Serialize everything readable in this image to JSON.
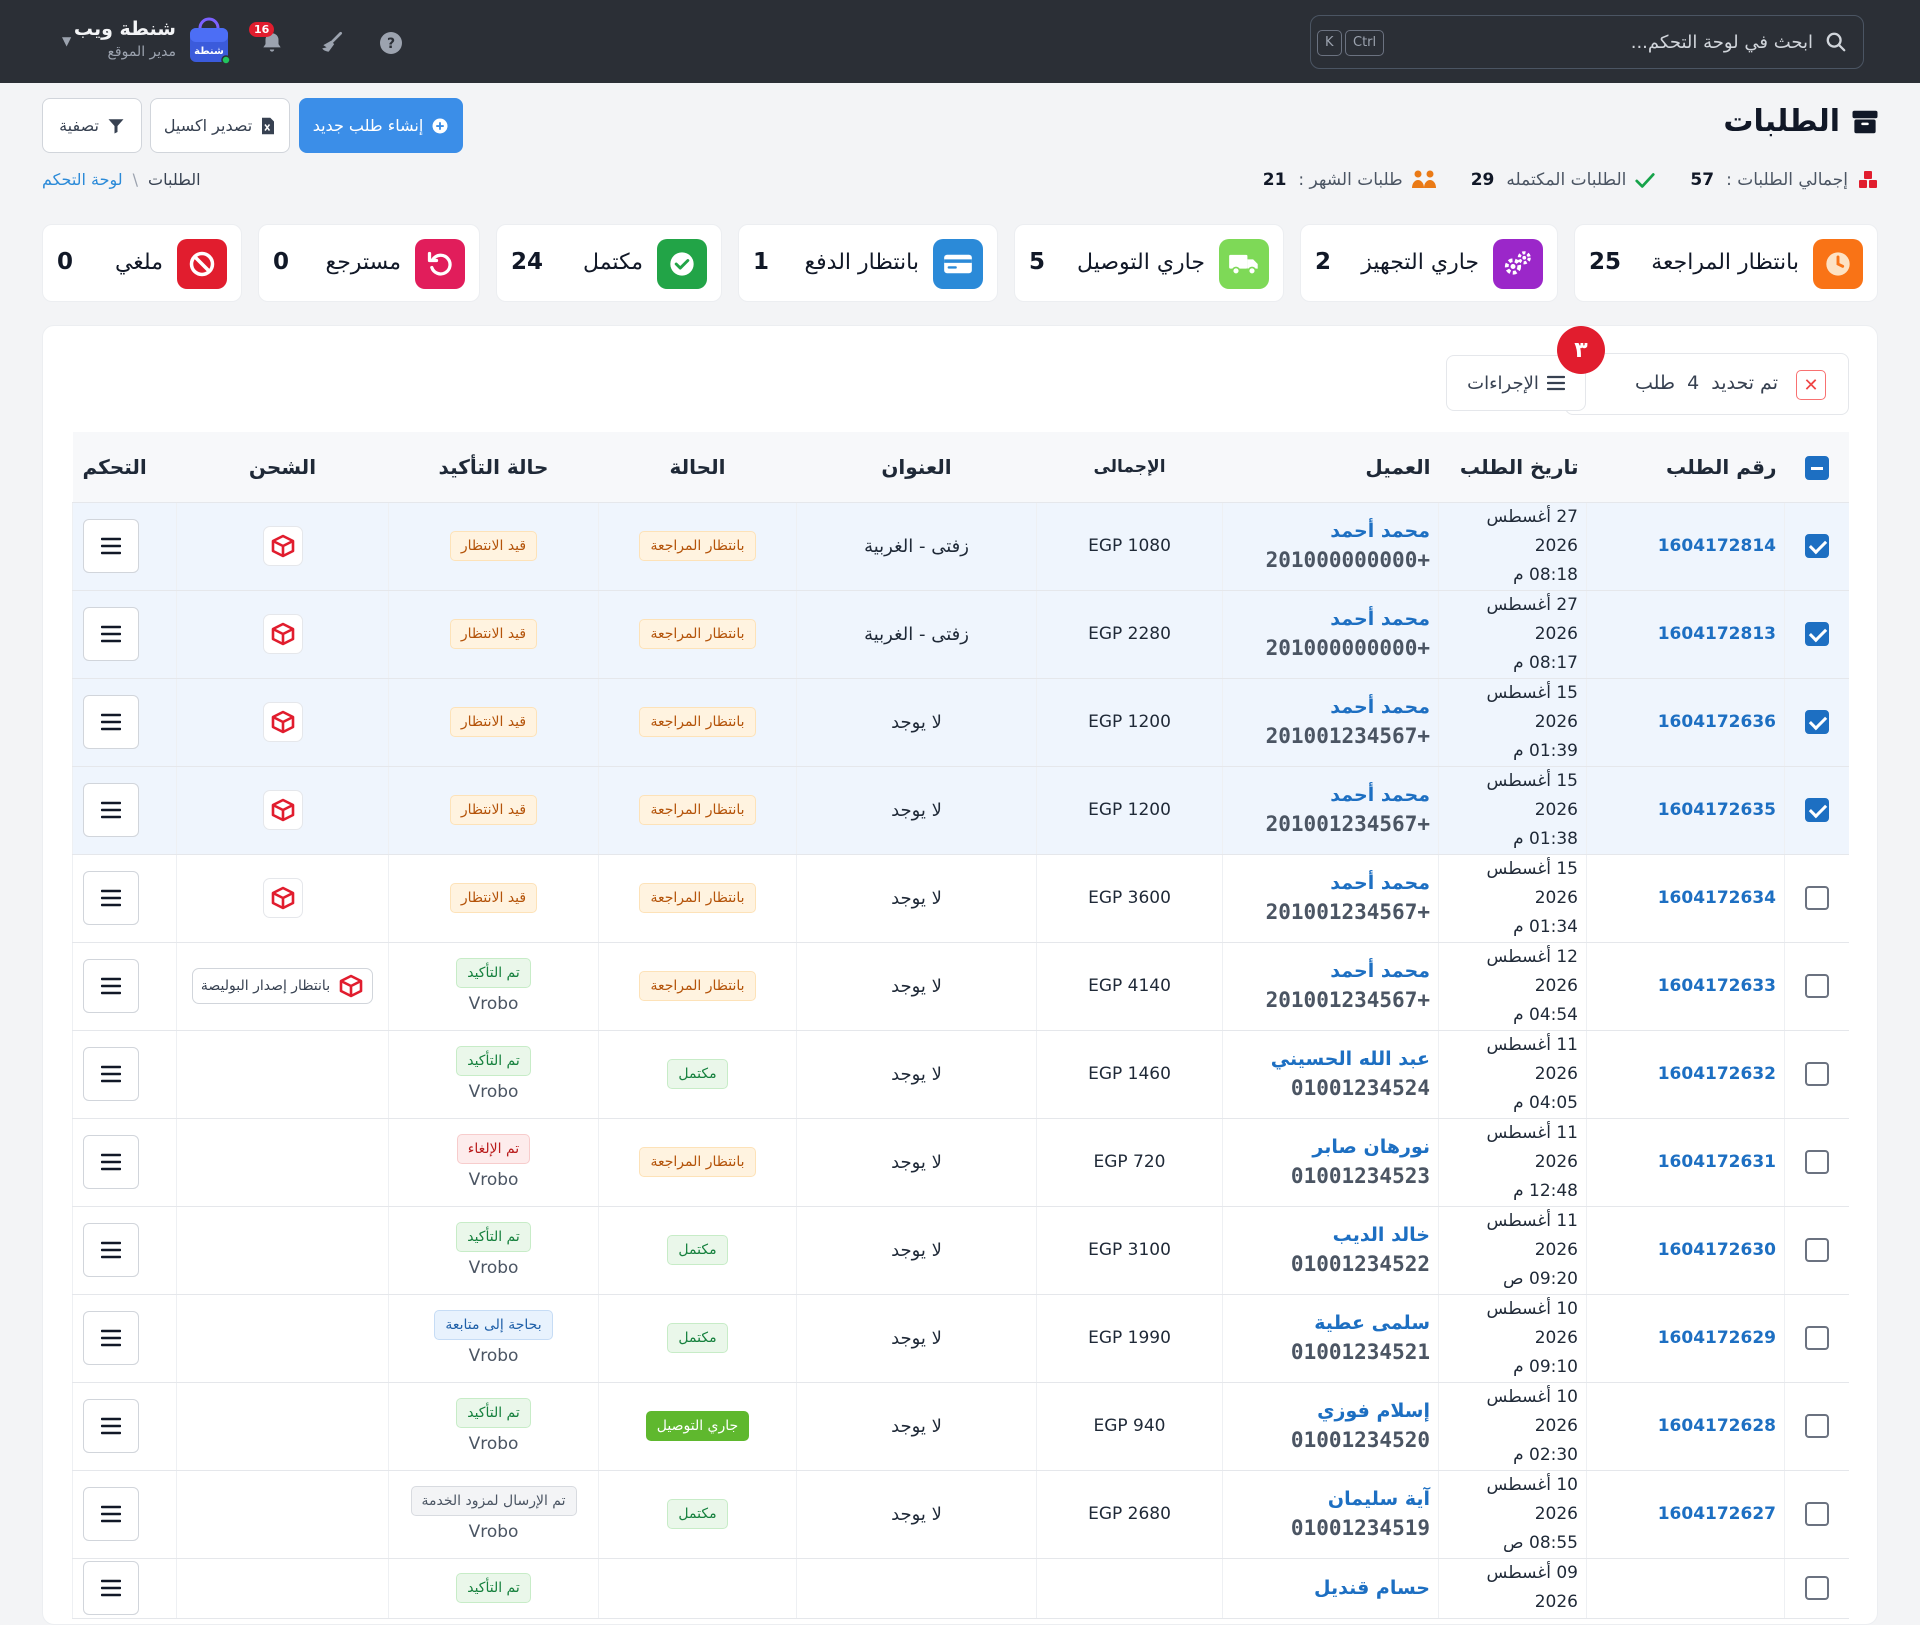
{
  "topbar": {
    "brand_name": "شنطة ويب",
    "brand_role": "مدير الموقع",
    "logo_text": "شنطة",
    "notifications_count": "16",
    "search_placeholder": "ابحث في لوحة التحكم...",
    "shortcut_keys": [
      "Ctrl",
      "K"
    ]
  },
  "page": {
    "title": "الطلبات",
    "stats": [
      {
        "label": "إجمالي الطلبات :",
        "value": "57",
        "icon": "boxes-icon",
        "color": "#e11d2e"
      },
      {
        "label": "الطلبات المكتمله",
        "value": "29",
        "icon": "check-icon",
        "color": "#16a34a"
      },
      {
        "label": "طلبات الشهر :",
        "value": "21",
        "icon": "people-icon",
        "color": "#ea7a16"
      }
    ],
    "breadcrumb": {
      "home": "لوحة التحكم",
      "current": "الطلبات"
    },
    "buttons": {
      "create": "إنشاء طلب جديد",
      "export": "تصدير اكسيل",
      "filter": "تصفية"
    }
  },
  "status_cards": [
    {
      "label": "بانتظار المراجعة",
      "count": "25",
      "icon": "clock-icon",
      "color": "#f97316"
    },
    {
      "label": "جاري التجهيز",
      "count": "2",
      "icon": "gears-icon",
      "color": "#9b27c9"
    },
    {
      "label": "جاري التوصيل",
      "count": "5",
      "icon": "truck-icon",
      "color": "#7ed957"
    },
    {
      "label": "بانتظار الدفع",
      "count": "1",
      "icon": "card-icon",
      "color": "#2b8ad8"
    },
    {
      "label": "مكتمل",
      "count": "24",
      "icon": "check-circle-icon",
      "color": "#22a447"
    },
    {
      "label": "مسترجع",
      "count": "0",
      "icon": "undo-icon",
      "color": "#e11d5b"
    },
    {
      "label": "ملغي",
      "count": "0",
      "icon": "ban-icon",
      "color": "#e11d2e"
    }
  ],
  "selection": {
    "text_before": "تم تحديد",
    "count": "4",
    "text_after": "طلب",
    "actions_label": "الإجراءات",
    "badge": "٣"
  },
  "table": {
    "headers": [
      "رقم الطلب",
      "تاريخ الطلب",
      "العميل",
      "الإجمالى",
      "العنوان",
      "الحالة",
      "حالة التأكيد",
      "الشحن",
      "التحكم"
    ],
    "rows": [
      {
        "id": "1604172814",
        "date": "27 أغسطس 2026",
        "time": "08:18 م",
        "name": "محمد أحمد",
        "phone": "+201000000000",
        "total": "EGP 1080",
        "address": "زفتى - الغربية",
        "status": "بانتظار المراجعة",
        "status_kind": "review",
        "confirm": "قيد الانتظار",
        "confirm_kind": "pending",
        "sub": "",
        "ship": "icon",
        "ship_text": "",
        "selected": true
      },
      {
        "id": "1604172813",
        "date": "27 أغسطس 2026",
        "time": "08:17 م",
        "name": "محمد أحمد",
        "phone": "+201000000000",
        "total": "EGP 2280",
        "address": "زفتى - الغربية",
        "status": "بانتظار المراجعة",
        "status_kind": "review",
        "confirm": "قيد الانتظار",
        "confirm_kind": "pending",
        "sub": "",
        "ship": "icon",
        "ship_text": "",
        "selected": true
      },
      {
        "id": "1604172636",
        "date": "15 أغسطس 2026",
        "time": "01:39 م",
        "name": "محمد أحمد",
        "phone": "+201001234567",
        "total": "EGP 1200",
        "address": "لا يوجد",
        "status": "بانتظار المراجعة",
        "status_kind": "review",
        "confirm": "قيد الانتظار",
        "confirm_kind": "pending",
        "sub": "",
        "ship": "icon",
        "ship_text": "",
        "selected": true
      },
      {
        "id": "1604172635",
        "date": "15 أغسطس 2026",
        "time": "01:38 م",
        "name": "محمد أحمد",
        "phone": "+201001234567",
        "total": "EGP 1200",
        "address": "لا يوجد",
        "status": "بانتظار المراجعة",
        "status_kind": "review",
        "confirm": "قيد الانتظار",
        "confirm_kind": "pending",
        "sub": "",
        "ship": "icon",
        "ship_text": "",
        "selected": true
      },
      {
        "id": "1604172634",
        "date": "15 أغسطس 2026",
        "time": "01:34 م",
        "name": "محمد أحمد",
        "phone": "+201001234567",
        "total": "EGP 3600",
        "address": "لا يوجد",
        "status": "بانتظار المراجعة",
        "status_kind": "review",
        "confirm": "قيد الانتظار",
        "confirm_kind": "pending",
        "sub": "",
        "ship": "icon",
        "ship_text": "",
        "selected": false
      },
      {
        "id": "1604172633",
        "date": "12 أغسطس 2026",
        "time": "04:54 م",
        "name": "محمد أحمد",
        "phone": "+201001234567",
        "total": "EGP 4140",
        "address": "لا يوجد",
        "status": "بانتظار المراجعة",
        "status_kind": "review",
        "confirm": "تم التأكيد",
        "confirm_kind": "confirmed",
        "sub": "Vrobo",
        "ship": "waiting",
        "ship_text": "بانتظار إصدار البوليصة",
        "selected": false
      },
      {
        "id": "1604172632",
        "date": "11 أغسطس 2026",
        "time": "04:05 م",
        "name": "عبد الله الحسيني",
        "phone": "01001234524",
        "total": "EGP 1460",
        "address": "لا يوجد",
        "status": "مكتمل",
        "status_kind": "done",
        "confirm": "تم التأكيد",
        "confirm_kind": "confirmed",
        "sub": "Vrobo",
        "ship": "none",
        "ship_text": "",
        "selected": false
      },
      {
        "id": "1604172631",
        "date": "11 أغسطس 2026",
        "time": "12:48 م",
        "name": "نورهان صابر",
        "phone": "01001234523",
        "total": "EGP 720",
        "address": "لا يوجد",
        "status": "بانتظار المراجعة",
        "status_kind": "review",
        "confirm": "تم الإلغاء",
        "confirm_kind": "cancel",
        "sub": "Vrobo",
        "ship": "none",
        "ship_text": "",
        "selected": false
      },
      {
        "id": "1604172630",
        "date": "11 أغسطس 2026",
        "time": "09:20 ص",
        "name": "خالد الديب",
        "phone": "01001234522",
        "total": "EGP 3100",
        "address": "لا يوجد",
        "status": "مكتمل",
        "status_kind": "done",
        "confirm": "تم التأكيد",
        "confirm_kind": "confirmed",
        "sub": "Vrobo",
        "ship": "none",
        "ship_text": "",
        "selected": false
      },
      {
        "id": "1604172629",
        "date": "10 أغسطس 2026",
        "time": "09:10 م",
        "name": "سلمى عطية",
        "phone": "01001234521",
        "total": "EGP 1990",
        "address": "لا يوجد",
        "status": "مكتمل",
        "status_kind": "done",
        "confirm": "بحاجة إلى متابعة",
        "confirm_kind": "follow",
        "sub": "Vrobo",
        "ship": "none",
        "ship_text": "",
        "selected": false
      },
      {
        "id": "1604172628",
        "date": "10 أغسطس 2026",
        "time": "02:30 م",
        "name": "إسلام فوزي",
        "phone": "01001234520",
        "total": "EGP 940",
        "address": "لا يوجد",
        "status": "جاري التوصيل",
        "status_kind": "delivering",
        "confirm": "تم التأكيد",
        "confirm_kind": "confirmed",
        "sub": "Vrobo",
        "ship": "none",
        "ship_text": "",
        "selected": false
      },
      {
        "id": "1604172627",
        "date": "10 أغسطس 2026",
        "time": "08:55 ص",
        "name": "آية سليمان",
        "phone": "01001234519",
        "total": "EGP 2680",
        "address": "لا يوجد",
        "status": "مكتمل",
        "status_kind": "done",
        "confirm": "تم الإرسال لمزود الخدمة",
        "confirm_kind": "sent",
        "sub": "Vrobo",
        "ship": "none",
        "ship_text": "",
        "selected": false
      },
      {
        "id": "",
        "date": "09 أغسطس 2026",
        "time": "",
        "name": "حسام قنديل",
        "phone": "",
        "total": "",
        "address": "",
        "status": "",
        "status_kind": "",
        "confirm": "تم التأكيد",
        "confirm_kind": "confirmed",
        "sub": "",
        "ship": "none",
        "ship_text": "",
        "selected": false
      }
    ]
  }
}
